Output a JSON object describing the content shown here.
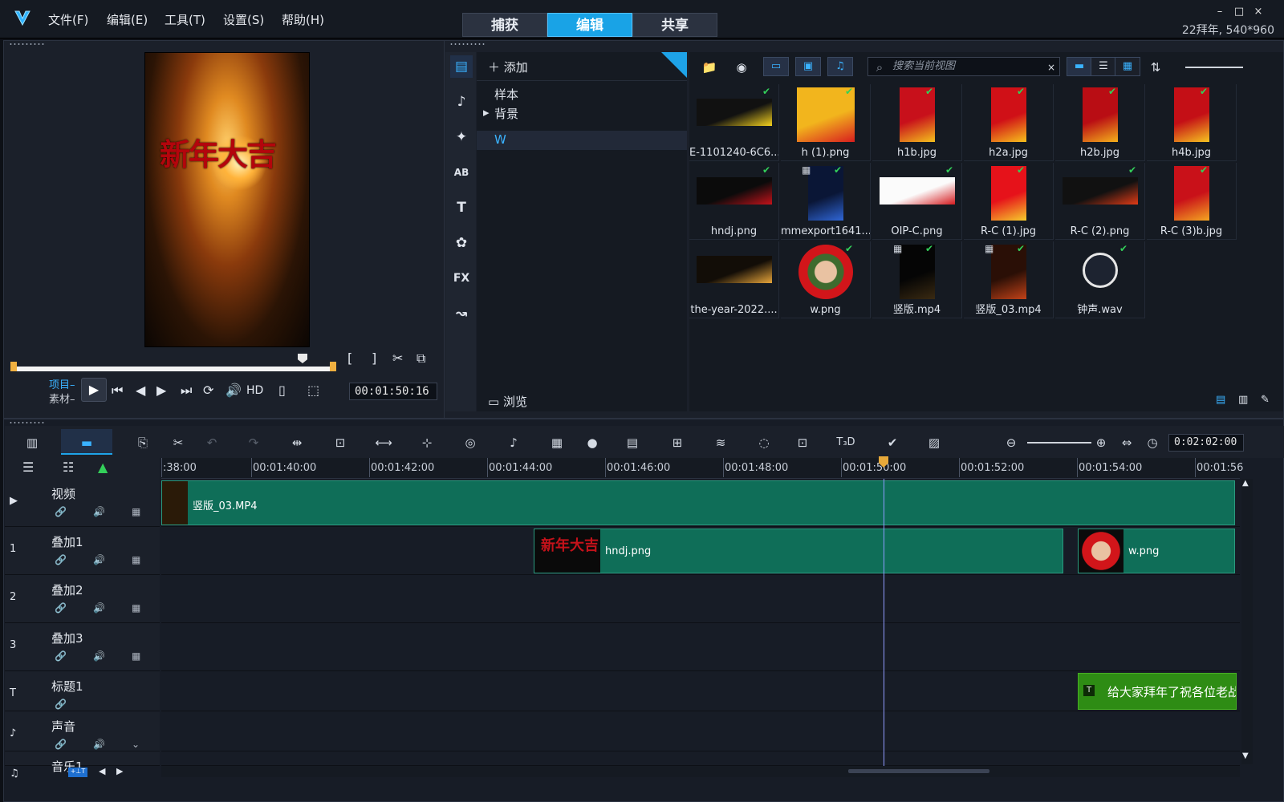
{
  "app": {
    "version_info": "22拜年, 540*960"
  },
  "menu": [
    "文件(F)",
    "编辑(E)",
    "工具(T)",
    "设置(S)",
    "帮助(H)"
  ],
  "mode_tabs": [
    {
      "label": "捕获",
      "active": false
    },
    {
      "label": "编辑",
      "active": true
    },
    {
      "label": "共享",
      "active": false
    }
  ],
  "window_controls": [
    "–",
    "□",
    "×"
  ],
  "player": {
    "preview_text": "新年大吉",
    "project_label": "项目–",
    "clip_label": "素材–",
    "timecode": "00:01:50:16",
    "hd_label": "HD"
  },
  "library": {
    "add_label": "添加",
    "folders": [
      "样本",
      "背景",
      "W"
    ],
    "active_folder": "W",
    "browse_label": "浏览",
    "search_placeholder": "搜索当前视图",
    "rail_icons": [
      "media-icon",
      "transition-icon",
      "effect-icon",
      "ab-icon",
      "title-icon",
      "filter-icon",
      "fx-icon",
      "path-icon"
    ],
    "items": [
      {
        "name": "E-1101240-6C6...",
        "kind": "image",
        "color": "#111111",
        "accent": "#f5d21e",
        "ratio": "wide",
        "checked": true
      },
      {
        "name": "h (1).png",
        "kind": "image",
        "color": "#f2b51d",
        "accent": "#d81e1e",
        "ratio": "square",
        "checked": true
      },
      {
        "name": "h1b.jpg",
        "kind": "image",
        "color": "#c8101b",
        "accent": "#f4c11d",
        "ratio": "tall",
        "checked": true
      },
      {
        "name": "h2a.jpg",
        "kind": "image",
        "color": "#d01017",
        "accent": "#f7c11c",
        "ratio": "tall",
        "checked": true
      },
      {
        "name": "h2b.jpg",
        "kind": "image",
        "color": "#b90d14",
        "accent": "#f5b11b",
        "ratio": "tall",
        "checked": true
      },
      {
        "name": "h4b.jpg",
        "kind": "image",
        "color": "#c40f16",
        "accent": "#f6c420",
        "ratio": "tall",
        "checked": true
      },
      {
        "name": "hndj.png",
        "kind": "image",
        "color": "#0b0b0b",
        "accent": "#c4121a",
        "ratio": "wide",
        "checked": true
      },
      {
        "name": "mmexport1641...",
        "kind": "video",
        "color": "#0a1636",
        "accent": "#2f66d6",
        "ratio": "tall",
        "checked": true
      },
      {
        "name": "OIP-C.png",
        "kind": "image",
        "color": "#fbfbfb",
        "accent": "#d51b1f",
        "ratio": "wide",
        "checked": true
      },
      {
        "name": "R-C (1).jpg",
        "kind": "image",
        "color": "#e6121a",
        "accent": "#f6cd2c",
        "ratio": "tall",
        "checked": true
      },
      {
        "name": "R-C (2).png",
        "kind": "image",
        "color": "#111111",
        "accent": "#e23b16",
        "ratio": "wide",
        "checked": true
      },
      {
        "name": "R-C (3)b.jpg",
        "kind": "image",
        "color": "#c91119",
        "accent": "#f4a521",
        "ratio": "tall",
        "checked": true
      },
      {
        "name": "the-year-2022....",
        "kind": "image",
        "color": "#120d07",
        "accent": "#e7a53a",
        "ratio": "wide",
        "checked": false
      },
      {
        "name": "w.png",
        "kind": "image",
        "color": "#d2151a",
        "accent": "#3e6b2e",
        "ratio": "square",
        "checked": true
      },
      {
        "name": "竖版.mp4",
        "kind": "video",
        "color": "#050505",
        "accent": "#3a2a12",
        "ratio": "tall",
        "checked": true
      },
      {
        "name": "竖版_03.mp4",
        "kind": "video",
        "color": "#2a0f06",
        "accent": "#c24218",
        "ratio": "tall",
        "checked": true
      },
      {
        "name": "钟声.wav",
        "kind": "audio",
        "color": "#1d2330",
        "accent": "#e6e6e6",
        "ratio": "square",
        "checked": true
      }
    ]
  },
  "timeline": {
    "timecode": "0:02:02:00",
    "ruler_labels": [
      ":38:00",
      "00:01:40:00",
      "00:01:42:00",
      "00:01:44:00",
      "00:01:46:00",
      "00:01:48:00",
      "00:01:50:00",
      "00:01:52:00",
      "00:01:54:00",
      "00:01:56"
    ],
    "tracks": [
      {
        "name": "视频",
        "icon": "video-track-icon",
        "badge": "▶"
      },
      {
        "name": "叠加1",
        "icon": "overlay1-icon",
        "badge": "1"
      },
      {
        "name": "叠加2",
        "icon": "overlay2-icon",
        "badge": "2"
      },
      {
        "name": "叠加3",
        "icon": "overlay3-icon",
        "badge": "3"
      },
      {
        "name": "标题1",
        "icon": "title-track-icon",
        "badge": "T"
      },
      {
        "name": "声音",
        "icon": "voice-track-icon",
        "badge": "♪"
      },
      {
        "name": "音乐1",
        "icon": "music-track-icon",
        "badge": "♫"
      }
    ],
    "clips": {
      "video": "竖版_03.MP4",
      "overlay1_a": "hndj.png",
      "overlay1_b": "w.png",
      "title": "给大家拜年了祝各位老战"
    }
  },
  "colors": {
    "accent": "#19a3e6",
    "clip": "#0f6e58",
    "title_clip": "#2e8c14"
  }
}
